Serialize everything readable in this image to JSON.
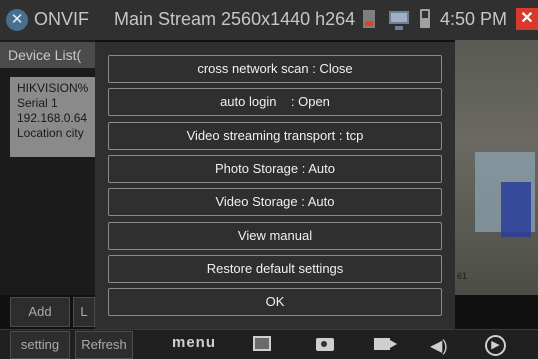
{
  "topbar": {
    "app_title": "ONVIF",
    "stream_title": "Main Stream 2560x1440 h264",
    "time": "4:50 PM",
    "close_glyph": "✕",
    "back_glyph": "✕"
  },
  "device_list": {
    "label": "Device List(",
    "device": {
      "name": "HIKVISION%",
      "serial": "Serial 1",
      "ip": "192.168.0.64",
      "location": "Location city"
    }
  },
  "video": {
    "overlay_label": "61"
  },
  "left_buttons": {
    "add": "Add",
    "partial": "L",
    "setting": "setting",
    "refresh": "Refresh"
  },
  "toolbar": {
    "menu": "menu",
    "icons": [
      "picture-icon",
      "camera-icon",
      "video-camera-icon",
      "volume-icon",
      "next-arrow-icon"
    ],
    "volume_glyph": "◀)",
    "next_glyph": "▶"
  },
  "menu": {
    "items": [
      "cross network scan : Close",
      "auto login    : Open",
      "Video streaming transport : tcp",
      "Photo Storage : Auto",
      "Video Storage : Auto",
      "View manual",
      "Restore default settings",
      "OK"
    ]
  },
  "colors": {
    "close_button": "#d8392d",
    "background": "#111111",
    "modal": "#2f2f2f"
  }
}
